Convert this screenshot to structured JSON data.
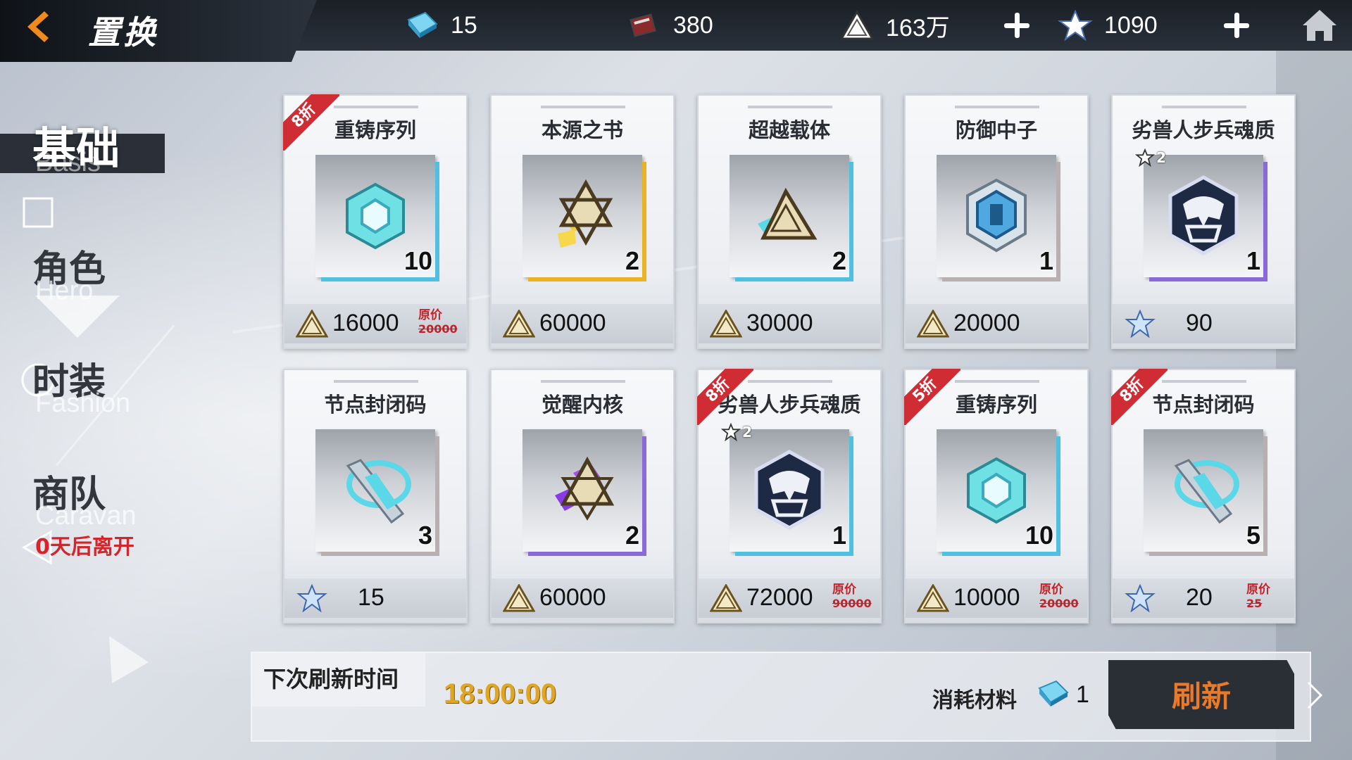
{
  "topbar": {
    "title": "置换",
    "resources": [
      {
        "icon": "crystal-chip-icon",
        "value": "15"
      },
      {
        "icon": "book-icon",
        "value": "380"
      },
      {
        "icon": "gold-triangle-icon",
        "value": "163万"
      },
      {
        "icon": "blue-star-icon",
        "value": "1090"
      }
    ]
  },
  "sidebar": {
    "items": [
      {
        "cn": "基础",
        "en": "Basis"
      },
      {
        "cn": "角色",
        "en": "Hero"
      },
      {
        "cn": "时装",
        "en": "Fashion"
      },
      {
        "cn": "商队",
        "en": "Caravan"
      }
    ],
    "caravan_note": "0天后离开"
  },
  "cards": [
    {
      "name": "重铸序列",
      "qty": "10",
      "price": "16000",
      "currency": "gold",
      "discount": "8折",
      "orig_label": "原价",
      "orig_price": "20000",
      "item_icon": "recast-sequence-icon",
      "frame_color": "#4fc0e0"
    },
    {
      "name": "本源之书",
      "qty": "2",
      "price": "60000",
      "currency": "gold",
      "discount": "",
      "orig_label": "",
      "orig_price": "",
      "item_icon": "origin-book-icon",
      "frame_color": "#e8b424"
    },
    {
      "name": "超越载体",
      "qty": "2",
      "price": "30000",
      "currency": "gold",
      "discount": "",
      "orig_label": "",
      "orig_price": "",
      "item_icon": "transcend-carrier-icon",
      "frame_color": "#4fc0e0"
    },
    {
      "name": "防御中子",
      "qty": "1",
      "price": "20000",
      "currency": "gold",
      "discount": "",
      "orig_label": "",
      "orig_price": "",
      "item_icon": "defense-neutron-icon",
      "frame_color": "#b8b0b0"
    },
    {
      "name": "劣兽人步兵魂质",
      "qty": "1",
      "price": "90",
      "currency": "star",
      "discount": "",
      "orig_label": "",
      "orig_price": "",
      "item_icon": "orc-soul-icon",
      "frame_color": "#8a6ad8",
      "star_level": "2"
    },
    {
      "name": "节点封闭码",
      "qty": "3",
      "price": "15",
      "currency": "star",
      "discount": "",
      "orig_label": "",
      "orig_price": "",
      "item_icon": "node-code-icon",
      "frame_color": "#b8b0b0"
    },
    {
      "name": "觉醒内核",
      "qty": "2",
      "price": "60000",
      "currency": "gold",
      "discount": "",
      "orig_label": "",
      "orig_price": "",
      "item_icon": "awaken-core-icon",
      "frame_color": "#8a6ad8"
    },
    {
      "name": "劣兽人步兵魂质",
      "qty": "1",
      "price": "72000",
      "currency": "gold",
      "discount": "8折",
      "orig_label": "原价",
      "orig_price": "90000",
      "item_icon": "orc-soul-icon",
      "frame_color": "#4fc0e0",
      "star_level": "2"
    },
    {
      "name": "重铸序列",
      "qty": "10",
      "price": "10000",
      "currency": "gold",
      "discount": "5折",
      "orig_label": "原价",
      "orig_price": "20000",
      "item_icon": "recast-sequence-icon",
      "frame_color": "#4fc0e0"
    },
    {
      "name": "节点封闭码",
      "qty": "5",
      "price": "20",
      "currency": "star",
      "discount": "8折",
      "orig_label": "原价",
      "orig_price": "25",
      "item_icon": "node-code-icon",
      "frame_color": "#b8b0b0"
    }
  ],
  "refresh": {
    "label": "下次刷新时间",
    "time": "18:00:00",
    "cost_label": "消耗材料",
    "cost_icon": "crystal-chip-icon",
    "cost_value": "1",
    "button_label": "刷新"
  },
  "colors": {
    "accent_orange": "#e87a2a",
    "discount_red": "#cf2c34",
    "time_gold": "#e0a622"
  }
}
